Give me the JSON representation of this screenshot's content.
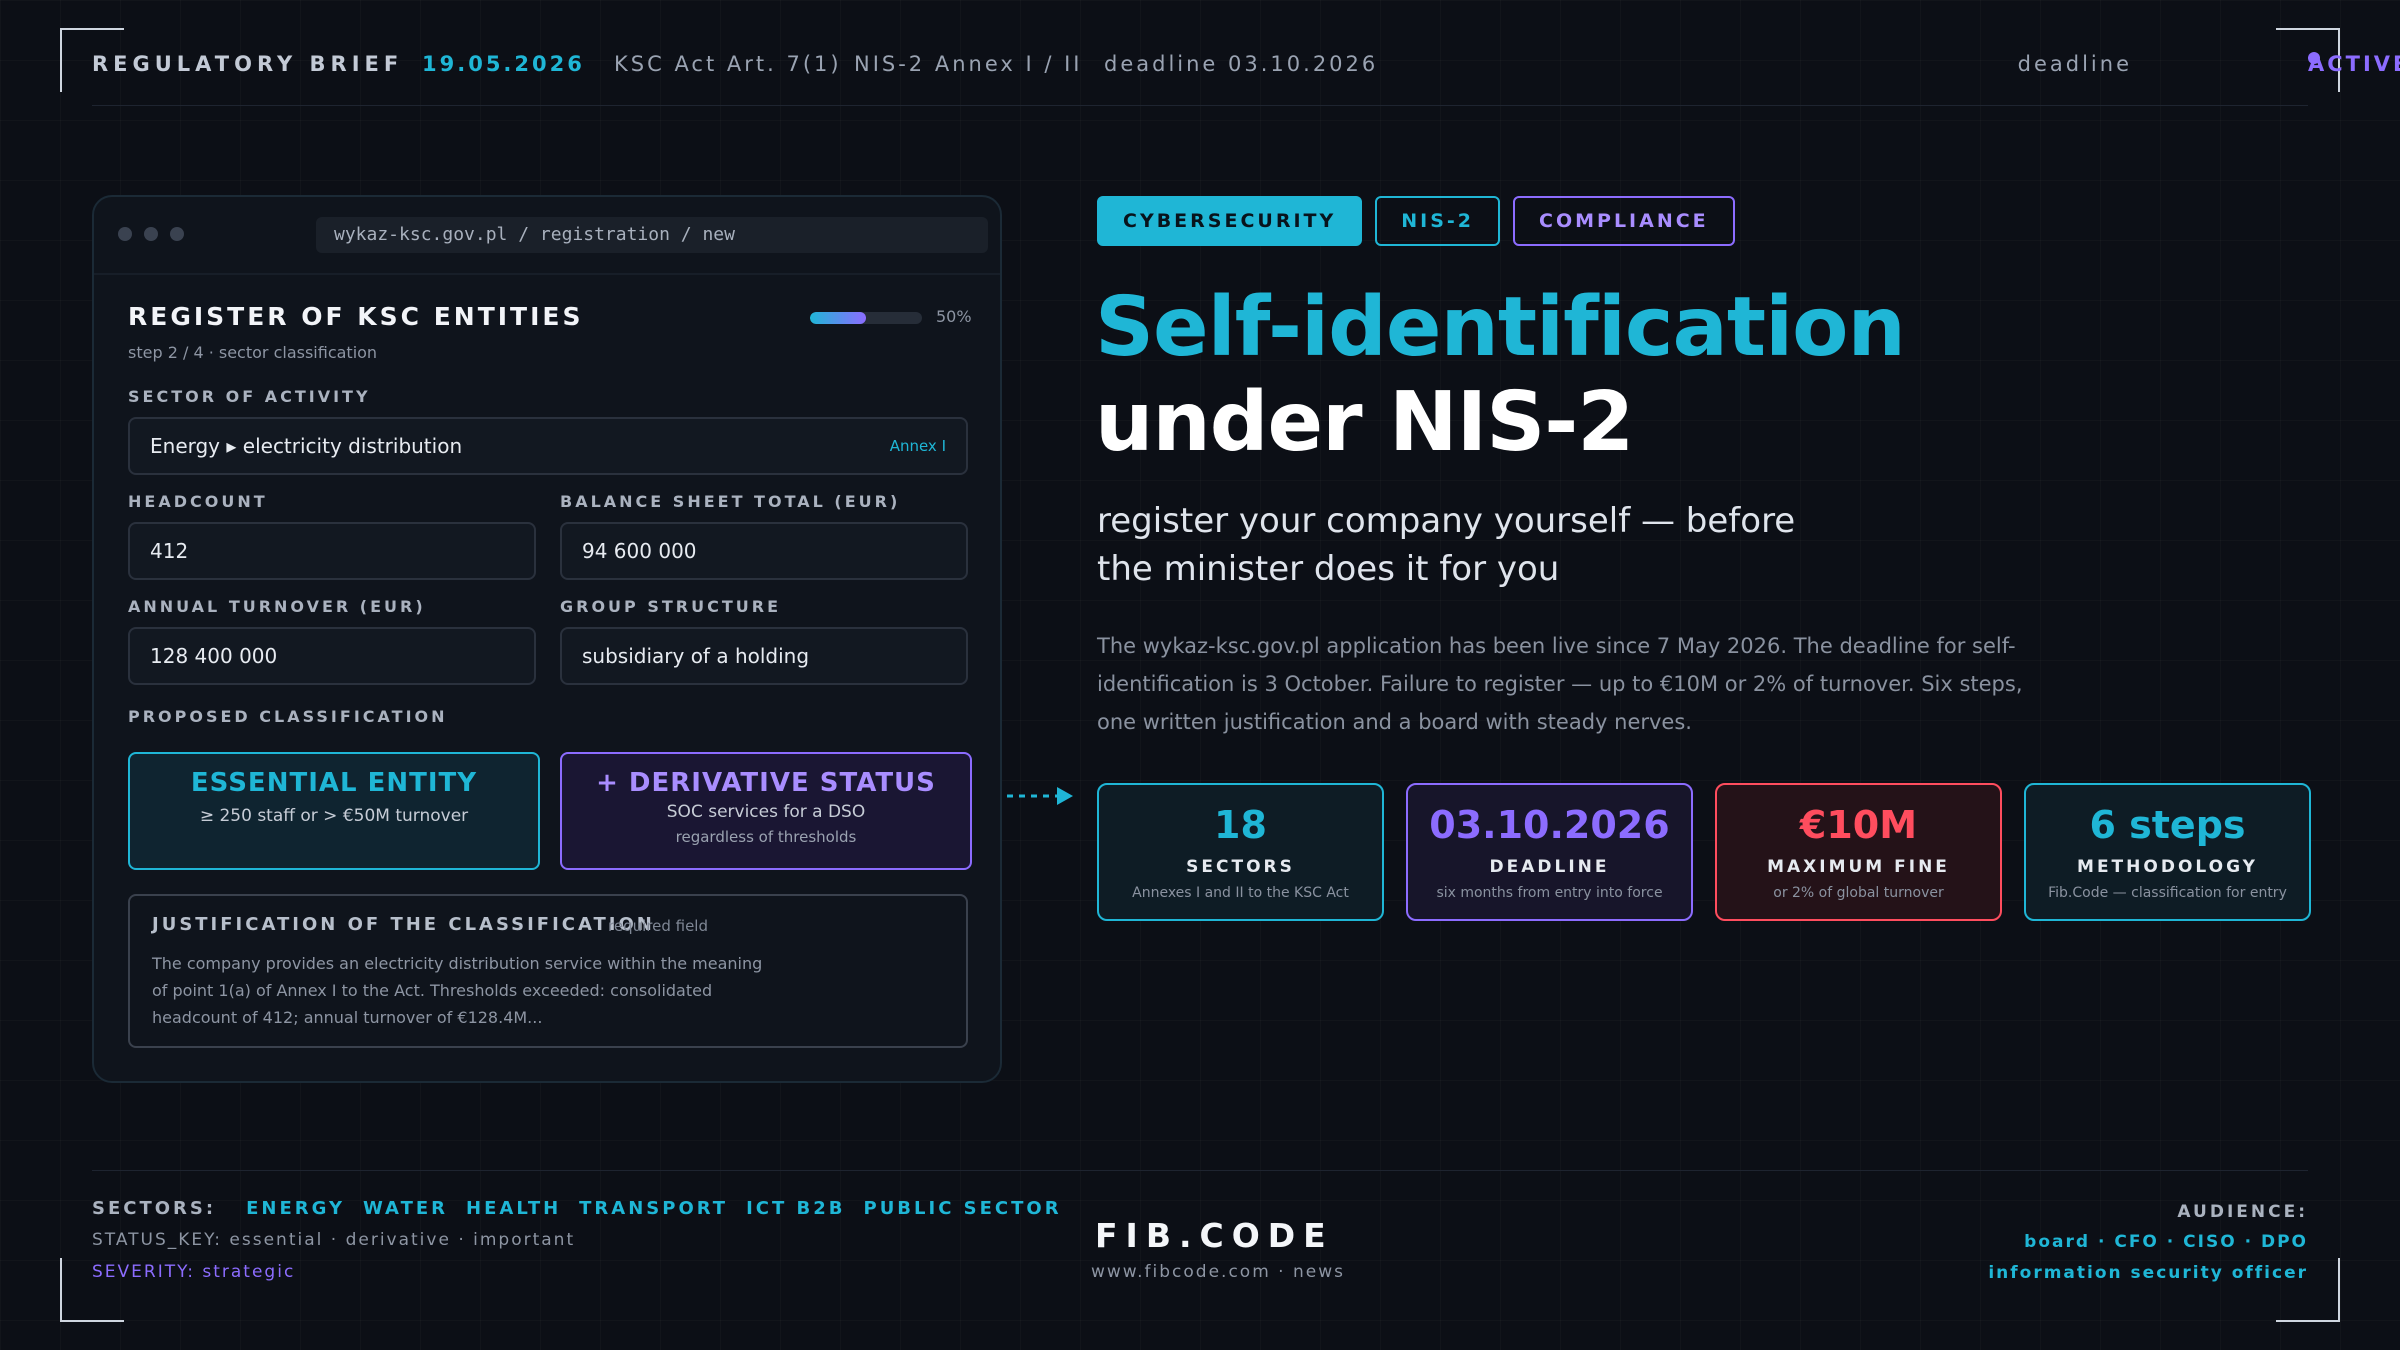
{
  "header": {
    "title": "REGULATORY BRIEF",
    "date": "19.05.2026",
    "act": "KSC Act Art. 7(1)",
    "annex": "NIS-2 Annex I / II",
    "deadline": "deadline 03.10.2026",
    "deadline_label": "deadline",
    "status": "ACTIVE"
  },
  "form": {
    "url": "wykaz-ksc.gov.pl / registration / new",
    "title": "REGISTER OF KSC ENTITIES",
    "step": "step 2 / 4 · sector classification",
    "progress_percent": 50,
    "progress_label": "50%",
    "sector_label": "SECTOR OF ACTIVITY",
    "sector_value": "Energy ▸ electricity distribution",
    "sector_annex": "Annex I",
    "headcount_label": "HEADCOUNT",
    "headcount_value": "412",
    "balance_label": "BALANCE SHEET TOTAL (EUR)",
    "balance_value": "94 600 000",
    "turnover_label": "ANNUAL TURNOVER (EUR)",
    "turnover_value": "128 400 000",
    "group_label": "GROUP STRUCTURE",
    "group_value": "subsidiary of a holding",
    "proposed_label": "PROPOSED CLASSIFICATION",
    "essential_title": "ESSENTIAL ENTITY",
    "essential_sub": "≥ 250 staff or > €50M turnover",
    "derivative_title": "+ DERIVATIVE STATUS",
    "derivative_sub": "SOC services for a DSO",
    "derivative_sub2": "regardless of thresholds",
    "justification_label": "JUSTIFICATION OF THE CLASSIFICATION",
    "justification_required": "required field",
    "justification_text": "The company provides an electricity distribution service within the meaning of point 1(a) of Annex I to the Act. Thresholds exceeded: consolidated headcount of 412; annual turnover of €128.4M..."
  },
  "tags": [
    "CYBERSECURITY",
    "NIS-2",
    "COMPLIANCE"
  ],
  "headline": {
    "line1": "Self-identification",
    "line2": "under NIS-2"
  },
  "subtitle": "register your company yourself — before the minister does it for you",
  "paragraph": "The wykaz-ksc.gov.pl application has been live since 7 May 2026. The deadline for self-identification is 3 October. Failure to register — up to €10M or 2% of turnover. Six steps, one written justification and a board with steady nerves.",
  "stats": [
    {
      "value": "18",
      "label": "SECTORS",
      "sub": "Annexes I and II to the KSC Act",
      "color": "#1fb6d6"
    },
    {
      "value": "03.10.2026",
      "label": "DEADLINE",
      "sub": "six months from entry into force",
      "color": "#8c6cff"
    },
    {
      "value": "€10M",
      "label": "MAXIMUM FINE",
      "sub": "or 2% of global turnover",
      "color": "#ff4d5e"
    },
    {
      "value": "6 steps",
      "label": "METHODOLOGY",
      "sub": "Fib.Code — classification for entry",
      "color": "#1fb6d6"
    }
  ],
  "footer": {
    "sectors_label": "SECTORS:",
    "sectors": [
      "ENERGY",
      "WATER",
      "HEALTH",
      "TRANSPORT",
      "ICT B2B",
      "PUBLIC SECTOR"
    ],
    "status_key": "STATUS_KEY: essential · derivative · important",
    "severity": "SEVERITY: strategic",
    "brand": "FIB.CODE",
    "site": "www.fibcode.com · news",
    "audience_label": "AUDIENCE:",
    "audience_line1": "board · CFO · CISO · DPO",
    "audience_line2": "information security officer"
  },
  "colors": {
    "accent_cyan": "#1fb6d6",
    "accent_purple": "#8c6cff",
    "accent_red": "#ff4d5e",
    "background": "#0c0f16"
  }
}
